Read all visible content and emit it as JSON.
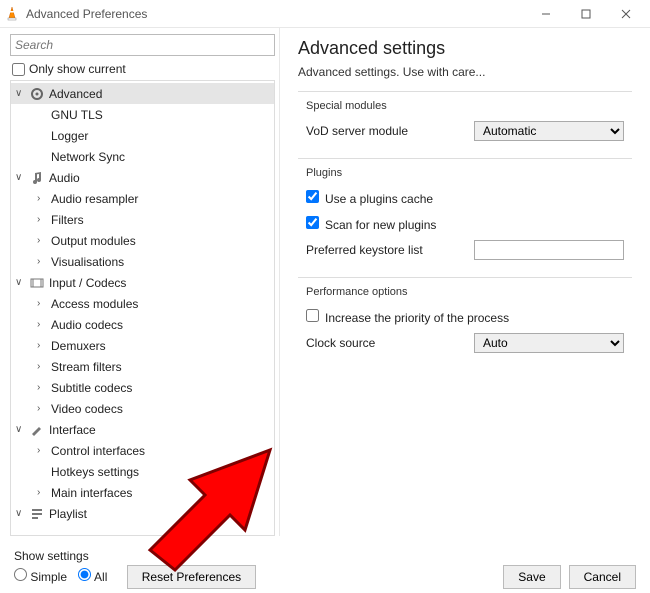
{
  "window": {
    "title": "Advanced Preferences"
  },
  "search": {
    "placeholder": "Search"
  },
  "only_show_current": "Only show current",
  "tree": {
    "advanced": "Advanced",
    "gnu_tls": "GNU TLS",
    "logger": "Logger",
    "network_sync": "Network Sync",
    "audio": "Audio",
    "audio_resampler": "Audio resampler",
    "filters": "Filters",
    "output_modules": "Output modules",
    "visualisations": "Visualisations",
    "input_codecs": "Input / Codecs",
    "access_modules": "Access modules",
    "audio_codecs": "Audio codecs",
    "demuxers": "Demuxers",
    "stream_filters": "Stream filters",
    "subtitle_codecs": "Subtitle codecs",
    "video_codecs": "Video codecs",
    "interface": "Interface",
    "control_interfaces": "Control interfaces",
    "hotkeys_settings": "Hotkeys settings",
    "main_interfaces": "Main interfaces",
    "playlist": "Playlist"
  },
  "page": {
    "title": "Advanced settings",
    "desc": "Advanced settings. Use with care...",
    "special_modules": "Special modules",
    "vod_server_module": "VoD server module",
    "vod_value": "Automatic",
    "plugins": "Plugins",
    "use_plugins_cache": "Use a plugins cache",
    "scan_new_plugins": "Scan for new plugins",
    "preferred_keystore": "Preferred keystore list",
    "keystore_value": "",
    "performance": "Performance options",
    "increase_priority": "Increase the priority of the process",
    "clock_source": "Clock source",
    "clock_value": "Auto"
  },
  "footer": {
    "show_settings": "Show settings",
    "simple": "Simple",
    "all": "All",
    "reset": "Reset Preferences",
    "save": "Save",
    "cancel": "Cancel"
  }
}
